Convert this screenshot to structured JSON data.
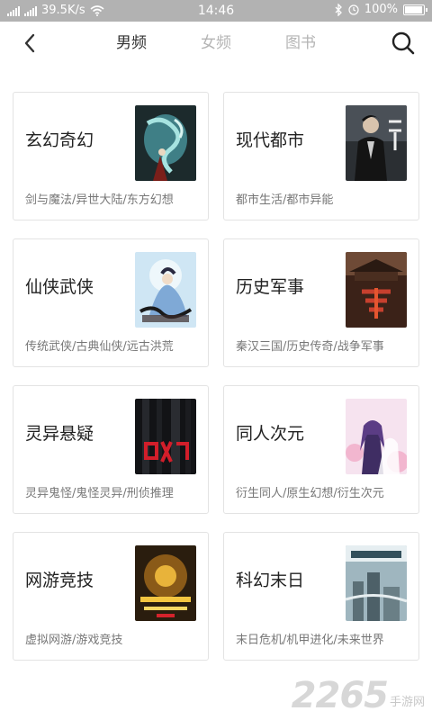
{
  "status_bar": {
    "speed": "39.5K/s",
    "time": "14:46",
    "battery_percent": "100%",
    "battery_level": 1.0,
    "icons": [
      "signal-icon",
      "wifi-icon",
      "bluetooth-icon",
      "battery-icon"
    ]
  },
  "nav": {
    "back_icon": "chevron-left-icon",
    "tabs": [
      {
        "label": "男频",
        "active": true
      },
      {
        "label": "女频",
        "active": false
      },
      {
        "label": "图书",
        "active": false
      }
    ],
    "search_icon": "search-icon"
  },
  "categories": [
    {
      "title": "玄幻奇幻",
      "tags": "剑与魔法/异世大陆/东方幻想"
    },
    {
      "title": "现代都市",
      "tags": "都市生活/都市异能"
    },
    {
      "title": "仙侠武侠",
      "tags": "传统武侠/古典仙侠/远古洪荒"
    },
    {
      "title": "历史军事",
      "tags": "秦汉三国/历史传奇/战争军事"
    },
    {
      "title": "灵异悬疑",
      "tags": "灵异鬼怪/鬼怪灵异/刑侦推理"
    },
    {
      "title": "同人次元",
      "tags": "衍生同人/原生幻想/衍生次元"
    },
    {
      "title": "网游竞技",
      "tags": "虚拟网游/游戏竞技"
    },
    {
      "title": "科幻末日",
      "tags": "末日危机/机甲进化/未来世界"
    }
  ],
  "watermark": {
    "number": "2265",
    "suffix": "手游网"
  },
  "colors": {
    "status_bar": "#b2b2b2",
    "active_tab": "#333333",
    "inactive_tab": "#b4b4b4",
    "card_border": "#e3e3e3"
  }
}
